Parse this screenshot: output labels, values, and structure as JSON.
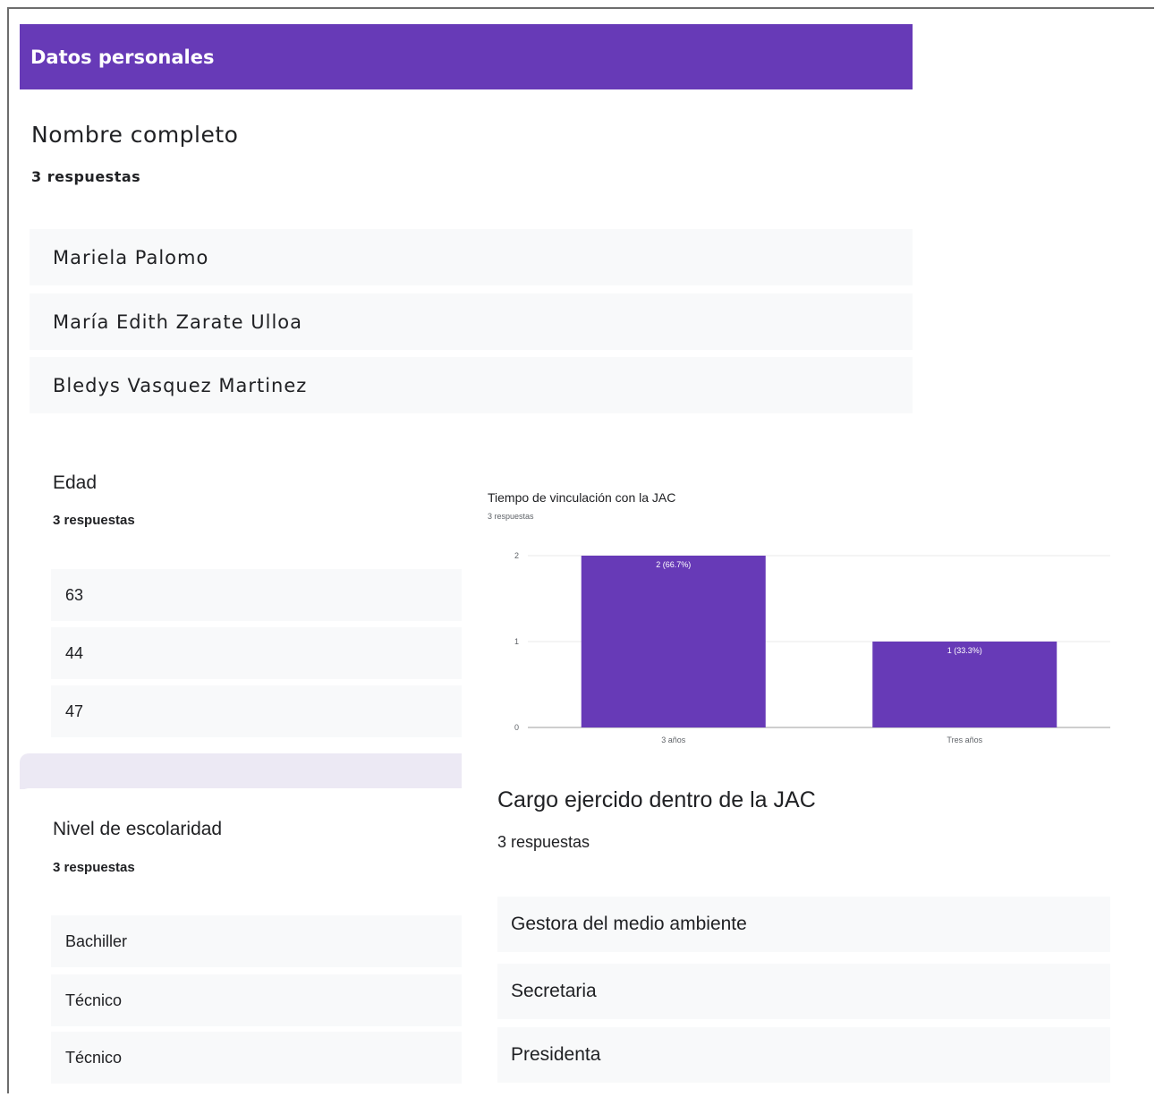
{
  "section": {
    "title": "Datos personales"
  },
  "nombre": {
    "title": "Nombre completo",
    "count": "3 respuestas",
    "responses": [
      "Mariela Palomo",
      "María Edith Zarate Ulloa",
      "Bledys Vasquez Martinez"
    ]
  },
  "edad": {
    "title": "Edad",
    "count": "3 respuestas",
    "responses": [
      "63",
      "44",
      "47"
    ]
  },
  "escolaridad": {
    "title": "Nivel de escolaridad",
    "count": "3 respuestas",
    "responses": [
      "Bachiller",
      "Técnico",
      "Técnico"
    ]
  },
  "cargo": {
    "title": "Cargo ejercido dentro de la JAC",
    "count": "3 respuestas",
    "responses": [
      "Gestora del medio ambiente",
      "Secretaria",
      "Presidenta"
    ]
  },
  "colors": {
    "accent": "#673ab7",
    "response_bg": "#f8f9fa"
  },
  "chart_data": {
    "type": "bar",
    "title": "Tiempo de vinculación con la JAC",
    "subtitle": "3 respuestas",
    "categories": [
      "3 años",
      "Tres años"
    ],
    "values": [
      2,
      1
    ],
    "data_labels": [
      "2 (66.7%)",
      "1 (33.3%)"
    ],
    "ylim": [
      0,
      2
    ],
    "yticks": [
      0,
      1,
      2
    ],
    "grid": true,
    "bar_color": "#673ab7"
  }
}
